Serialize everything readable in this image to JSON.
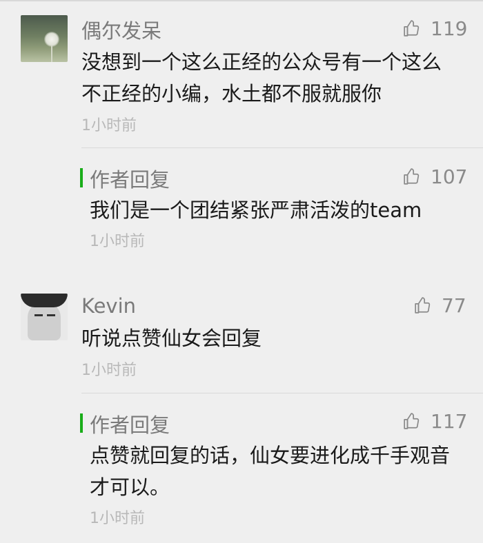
{
  "comments": [
    {
      "author": "偶尔发呆",
      "likes": "119",
      "text": "没想到一个这么正经的公众号有一个这么不正经的小编，水土都不服就服你",
      "time": "1小时前",
      "reply": {
        "label": "作者回复",
        "likes": "107",
        "text": "我们是一个团结紧张严肃活泼的team",
        "time": "1小时前"
      }
    },
    {
      "author": "Kevin",
      "likes": "77",
      "text": "听说点赞仙女会回复",
      "time": "1小时前",
      "reply": {
        "label": "作者回复",
        "likes": "117",
        "text": "点赞就回复的话，仙女要进化成千手观音才可以。",
        "time": "1小时前"
      }
    }
  ],
  "icons": {
    "like": "thumbs-up-icon"
  },
  "colors": {
    "reply_bar": "#19ad19",
    "background": "#efefef"
  }
}
